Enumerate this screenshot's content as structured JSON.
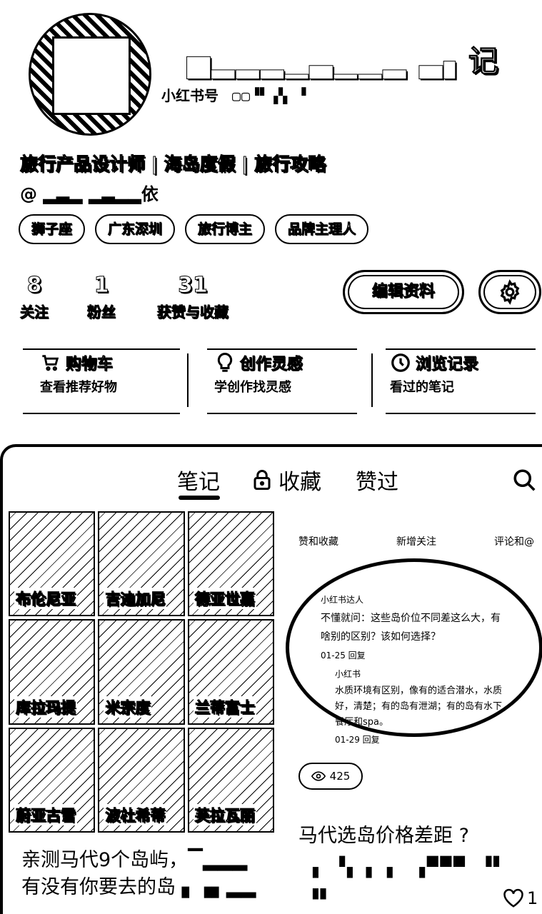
{
  "profile": {
    "name": "▅▂▂▂▁▃▁▁▂ ▃▖记",
    "id_label": "小红书号",
    "id_value": "▢▢▝▘▗▚ ▝",
    "bio": "旅行产品设计师 | 海岛度假 | 旅行攻略",
    "at": "@ ▂▃▂  ▂▃▂▂依",
    "tags": [
      "狮子座",
      "广东深圳",
      "旅行博主",
      "品牌主理人"
    ]
  },
  "stats": [
    {
      "num": "8",
      "label": "关注"
    },
    {
      "num": "1",
      "label": "粉丝"
    },
    {
      "num": "31",
      "label": "获赞与收藏"
    }
  ],
  "actions": {
    "edit": "编辑资料",
    "settings_icon": "gear-icon"
  },
  "quick": [
    {
      "icon": "cart-icon",
      "title": "购物车",
      "sub": "查看推荐好物"
    },
    {
      "icon": "bulb-icon",
      "title": "创作灵感",
      "sub": "学创作找灵感"
    },
    {
      "icon": "clock-icon",
      "title": "浏览记录",
      "sub": "看过的笔记"
    }
  ],
  "tabs": {
    "notes": "笔记",
    "collect": "收藏",
    "liked": "赞过"
  },
  "note1": {
    "grid": [
      "布伦尼亚",
      "吉迪加尼",
      "德亚世嘉",
      "库拉玛提",
      "米宗度",
      "兰蒂富士",
      "蔚亚古雪",
      "波杜希蒂",
      "芙拉瓦丽"
    ],
    "title": "亲测马代9个岛屿，▔▂▂▂ 有没有你要去的岛 ▖▗▖▂▂"
  },
  "note2": {
    "top_items": [
      "赞和收藏",
      "新增关注",
      "评论和@"
    ],
    "c1_user": "小红书达人",
    "c1_text": "不懂就问：这些岛价位不同差这么大，有啥别的区别？该如何选择？",
    "c1_time": "01-25 回复",
    "c2_user": "小红书",
    "c2_text": "水质环境有区别，像有的适合潜水，水质好，清楚；有的岛有泄湖；有的岛有水下餐厅和spa。",
    "c2_time": "01-29 回复",
    "views": "425",
    "title": "马代选岛价格差距 ?",
    "title_line2": "▗ ▝▖▗ ▖ ▗▀▀▀ ▝▘ ▗▖",
    "likes": "1"
  }
}
